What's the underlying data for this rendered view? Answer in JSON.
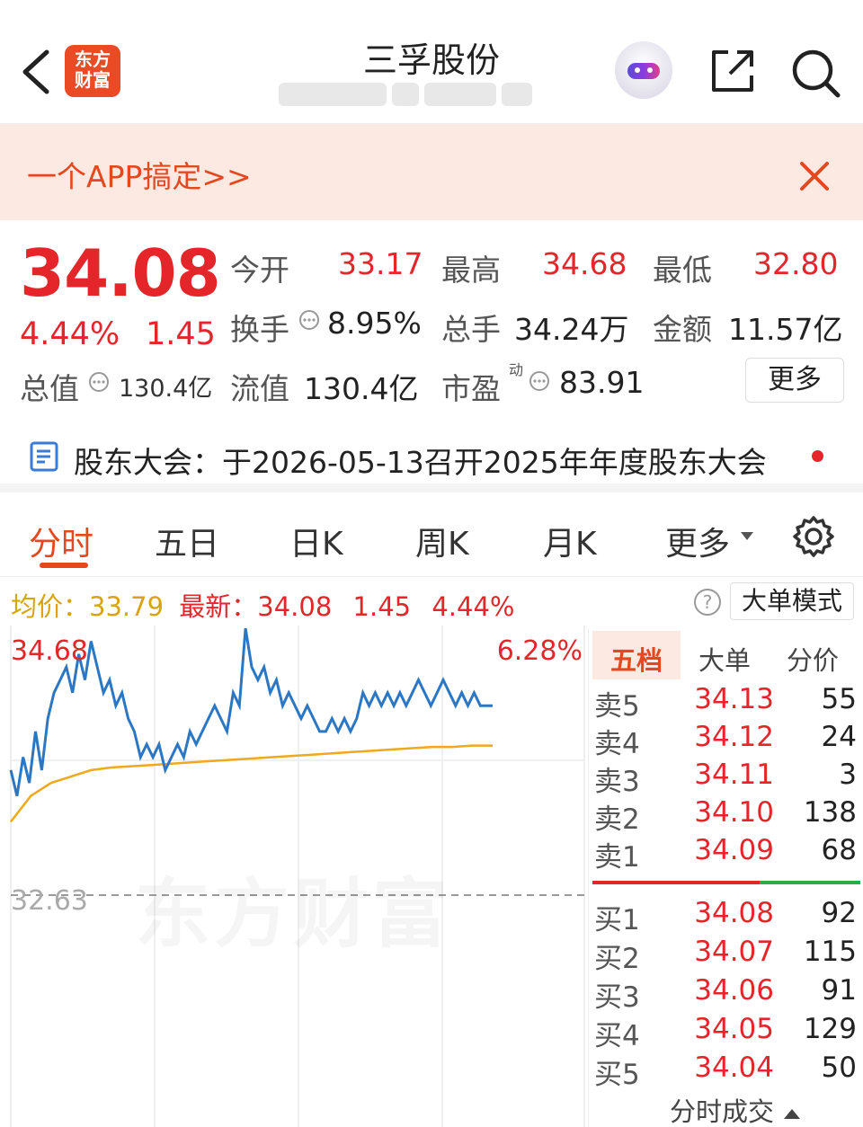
{
  "header": {
    "logo_text_line1": "东方",
    "logo_text_line2": "财富",
    "title": "三孚股份"
  },
  "banner": {
    "text": "一个APP搞定>>"
  },
  "quote": {
    "price": "34.08",
    "change_pct": "4.44%",
    "change": "1.45",
    "total_value_label": "总值",
    "total_value": "130.4亿",
    "open_label": "今开",
    "open": "33.17",
    "high_label": "最高",
    "high": "34.68",
    "low_label": "最低",
    "low": "32.80",
    "turnover_label": "换手",
    "turnover": "8.95%",
    "volume_label": "总手",
    "volume": "34.24万",
    "amount_label": "金额",
    "amount": "11.57亿",
    "float_value_label": "流值",
    "float_value": "130.4亿",
    "pe_label": "市盈",
    "pe_sup": "动",
    "pe": "83.91",
    "more_label": "更多"
  },
  "notice": {
    "text": "股东大会：于2026-05-13召开2025年年度股东大会"
  },
  "tabs": [
    {
      "label": "分时"
    },
    {
      "label": "五日"
    },
    {
      "label": "日K"
    },
    {
      "label": "周K"
    },
    {
      "label": "月K"
    },
    {
      "label": "更多"
    }
  ],
  "info_line": {
    "avg_label": "均价：",
    "avg": "33.79",
    "latest_label": "最新：",
    "latest": "34.08",
    "change": "1.45",
    "change_pct": "4.44%",
    "big_order_mode": "大单模式"
  },
  "chart_labels": {
    "top_price": "34.68",
    "top_pct": "6.28%",
    "ref_price": "32.63",
    "watermark": "东方财富"
  },
  "chart_data": {
    "type": "line",
    "ylim": [
      32.63,
      34.68
    ],
    "reference": 32.63,
    "series": [
      {
        "values": [
          33.6,
          33.4,
          33.7,
          33.5,
          33.9,
          33.6,
          34.0,
          34.2,
          34.3,
          34.4,
          34.2,
          34.5,
          34.3,
          34.6,
          34.4,
          34.2,
          34.3,
          34.1,
          34.2,
          34.0,
          33.9,
          33.7,
          33.8,
          33.7,
          33.8,
          33.6,
          33.7,
          33.8,
          33.7,
          33.9,
          33.8,
          33.9,
          34.0,
          34.1,
          34.0,
          33.9,
          34.2,
          34.1,
          34.7,
          34.4,
          34.3,
          34.4,
          34.2,
          34.3,
          34.1,
          34.2,
          34.1,
          34.0,
          34.1,
          34.0,
          33.9,
          33.9,
          34.0,
          33.9,
          34.0,
          33.9,
          34.0,
          34.2,
          34.1,
          34.2,
          34.1,
          34.2,
          34.1,
          34.2,
          34.1,
          34.2,
          34.3,
          34.2,
          34.1,
          34.2,
          34.3,
          34.2,
          34.1,
          34.2,
          34.1,
          34.2,
          34.1,
          34.1,
          34.1
        ]
      },
      {
        "values": [
          33.2,
          33.4,
          33.5,
          33.55,
          33.6,
          33.62,
          33.63,
          33.64,
          33.65,
          33.66,
          33.67,
          33.68,
          33.69,
          33.7,
          33.71,
          33.72,
          33.73,
          33.74,
          33.75,
          33.76,
          33.77,
          33.78,
          33.78,
          33.79,
          33.79
        ]
      }
    ]
  },
  "order_book": {
    "tabs": [
      "五档",
      "大单",
      "分价"
    ],
    "sell": [
      {
        "label": "卖5",
        "price": "34.13",
        "vol": "55"
      },
      {
        "label": "卖4",
        "price": "34.12",
        "vol": "24"
      },
      {
        "label": "卖3",
        "price": "34.11",
        "vol": "3"
      },
      {
        "label": "卖2",
        "price": "34.10",
        "vol": "138"
      },
      {
        "label": "卖1",
        "price": "34.09",
        "vol": "68"
      }
    ],
    "buy": [
      {
        "label": "买1",
        "price": "34.08",
        "vol": "92"
      },
      {
        "label": "买2",
        "price": "34.07",
        "vol": "115"
      },
      {
        "label": "买3",
        "price": "34.06",
        "vol": "91"
      },
      {
        "label": "买4",
        "price": "34.05",
        "vol": "129"
      },
      {
        "label": "买5",
        "price": "34.04",
        "vol": "50"
      }
    ],
    "bottom_label": "分时成交"
  },
  "colors": {
    "up": "#e4262b",
    "accent": "#e4481f",
    "price_line": "#2b77c4",
    "avg_line": "#f0a81c",
    "down": "#2eaa4a"
  }
}
